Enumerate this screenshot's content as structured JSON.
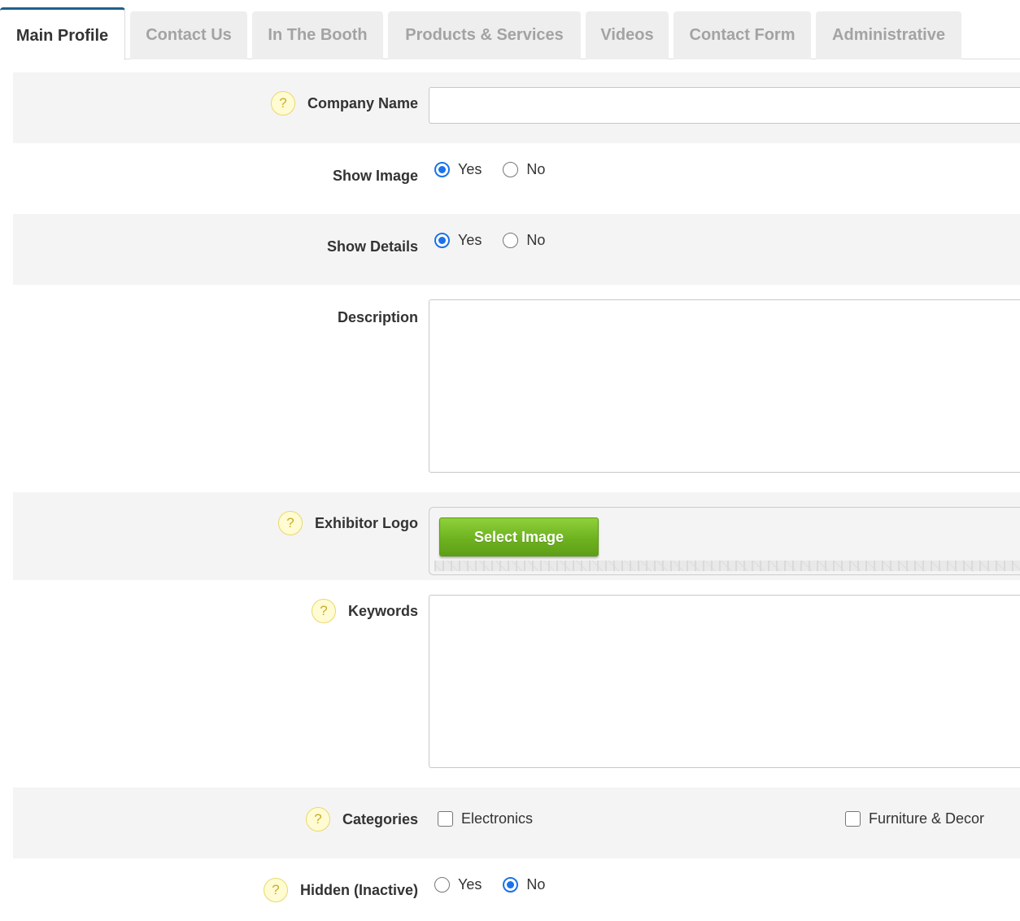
{
  "tabs": [
    {
      "label": "Main Profile",
      "active": true
    },
    {
      "label": "Contact Us",
      "active": false
    },
    {
      "label": "In The Booth",
      "active": false
    },
    {
      "label": "Products & Services",
      "active": false
    },
    {
      "label": "Videos",
      "active": false
    },
    {
      "label": "Contact Form",
      "active": false
    },
    {
      "label": "Administrative",
      "active": false
    }
  ],
  "form": {
    "help_glyph": "?",
    "company_name": {
      "label": "Company Name",
      "value": ""
    },
    "show_image": {
      "label": "Show Image",
      "options": [
        "Yes",
        "No"
      ],
      "selected": "Yes"
    },
    "show_details": {
      "label": "Show Details",
      "options": [
        "Yes",
        "No"
      ],
      "selected": "Yes"
    },
    "description": {
      "label": "Description",
      "value": ""
    },
    "exhibitor_logo": {
      "label": "Exhibitor Logo",
      "button_label": "Select Image"
    },
    "keywords": {
      "label": "Keywords",
      "value": ""
    },
    "categories": {
      "label": "Categories",
      "options": [
        "Electronics",
        "Furniture & Decor"
      ],
      "checked": []
    },
    "hidden": {
      "label": "Hidden (Inactive)",
      "options": [
        "Yes",
        "No"
      ],
      "selected": "No"
    }
  },
  "colors": {
    "accent": "#1e5f8c",
    "radio_checked": "#1a73e8",
    "button_green": "#6eb220",
    "help_badge": "#fffbd3"
  }
}
